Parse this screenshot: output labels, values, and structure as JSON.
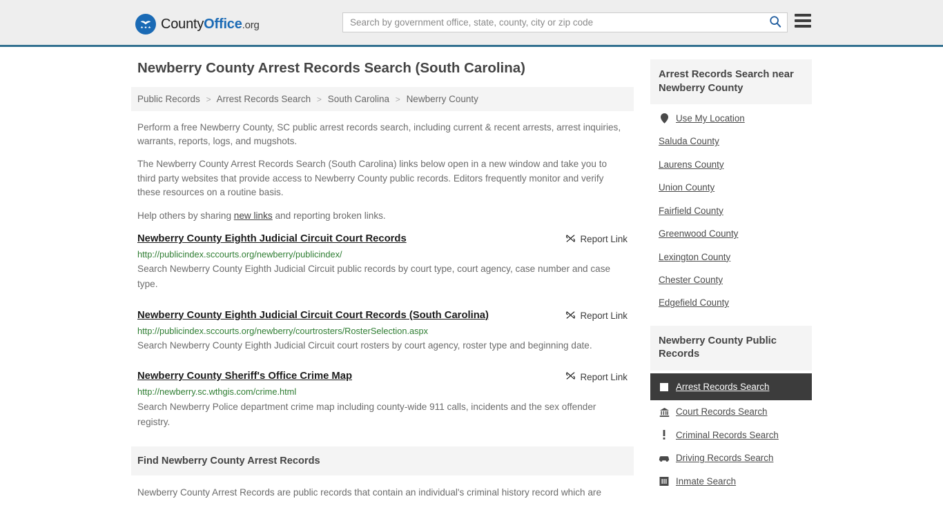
{
  "header": {
    "logo": {
      "icon": "eagle-shield-logo-icon",
      "part1": "County",
      "part2": "Office",
      "part3": ".org"
    },
    "search": {
      "placeholder": "Search by government office, state, county, city or zip code",
      "value": "",
      "search_icon": "search-icon"
    },
    "menu_icon": "hamburger-menu-icon"
  },
  "page": {
    "title": "Newberry County Arrest Records Search (South Carolina)"
  },
  "breadcrumb": {
    "separator": ">",
    "items": [
      {
        "label": "Public Records"
      },
      {
        "label": "Arrest Records Search"
      },
      {
        "label": "South Carolina"
      },
      {
        "label": "Newberry County"
      }
    ]
  },
  "intro": {
    "p1": "Perform a free Newberry County, SC public arrest records search, including current & recent arrests, arrest inquiries, warrants, reports, logs, and mugshots.",
    "p2": "The Newberry County Arrest Records Search (South Carolina) links below open in a new window and take you to third party websites that provide access to Newberry County public records. Editors frequently monitor and verify these resources on a routine basis.",
    "p3_before": "Help others by sharing ",
    "p3_link": "new links",
    "p3_after": " and reporting broken links."
  },
  "results": {
    "report_label": "Report Link",
    "report_icon": "broken-link-icon",
    "items": [
      {
        "title": "Newberry County Eighth Judicial Circuit Court Records",
        "url": "http://publicindex.sccourts.org/newberry/publicindex/",
        "description": "Search Newberry County Eighth Judicial Circuit public records by court type, court agency, case number and case type."
      },
      {
        "title": "Newberry County Eighth Judicial Circuit Court Records (South Carolina)",
        "url": "http://publicindex.sccourts.org/newberry/courtrosters/RosterSelection.aspx",
        "description": "Search Newberry County Eighth Judicial Circuit court rosters by court agency, roster type and beginning date."
      },
      {
        "title": "Newberry County Sheriff's Office Crime Map",
        "url": "http://newberry.sc.wthgis.com/crime.html",
        "description": "Search Newberry Police department crime map including county-wide 911 calls, incidents and the sex offender registry."
      }
    ]
  },
  "find_section": {
    "heading": "Find Newberry County Arrest Records",
    "body": "Newberry County Arrest Records are public records that contain an individual's criminal history record which are"
  },
  "sidebar": {
    "near_panel": {
      "title": "Arrest Records Search near Newberry County",
      "items": [
        {
          "label": "Use My Location",
          "icon": "map-pin-icon"
        },
        {
          "label": "Saluda County",
          "icon": ""
        },
        {
          "label": "Laurens County",
          "icon": ""
        },
        {
          "label": "Union County",
          "icon": ""
        },
        {
          "label": "Fairfield County",
          "icon": ""
        },
        {
          "label": "Greenwood County",
          "icon": ""
        },
        {
          "label": "Lexington County",
          "icon": ""
        },
        {
          "label": "Chester County",
          "icon": ""
        },
        {
          "label": "Edgefield County",
          "icon": ""
        }
      ]
    },
    "records_panel": {
      "title": "Newberry County Public Records",
      "items": [
        {
          "label": "Arrest Records Search",
          "icon": "fingerprint-card-icon",
          "active": true
        },
        {
          "label": "Court Records Search",
          "icon": "courthouse-icon",
          "active": false
        },
        {
          "label": "Criminal Records Search",
          "icon": "exclamation-icon",
          "active": false
        },
        {
          "label": "Driving Records Search",
          "icon": "car-icon",
          "active": false
        },
        {
          "label": "Inmate Search",
          "icon": "jail-building-icon",
          "active": false
        }
      ]
    }
  },
  "colors": {
    "header_bg": "#eeeeee",
    "header_border": "#31708f",
    "brand_blue": "#1a6ab5",
    "url_green": "#2e7d32",
    "panel_bg": "#f4f4f4",
    "active_bg": "#3c3c3c"
  }
}
